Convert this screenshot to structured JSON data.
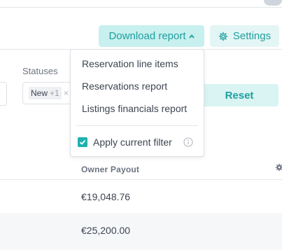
{
  "header": {
    "download_label": "Download report",
    "settings_label": "Settings"
  },
  "filters": {
    "statuses_label": "Statuses",
    "status_chip": "New",
    "status_chip_count": "+1",
    "chip_close": "×",
    "reset_label": "Reset"
  },
  "dropdown": {
    "items": [
      "Reservation line items",
      "Reservations report",
      "Listings financials report"
    ],
    "apply_filter_label": "Apply current filter",
    "apply_filter_checked": true
  },
  "table": {
    "column_header": "Owner Payout",
    "rows": [
      "€19,048.76",
      "€25,200.00"
    ]
  },
  "colors": {
    "accent": "#1f9f9e",
    "button_bg": "#c7f0ef"
  }
}
